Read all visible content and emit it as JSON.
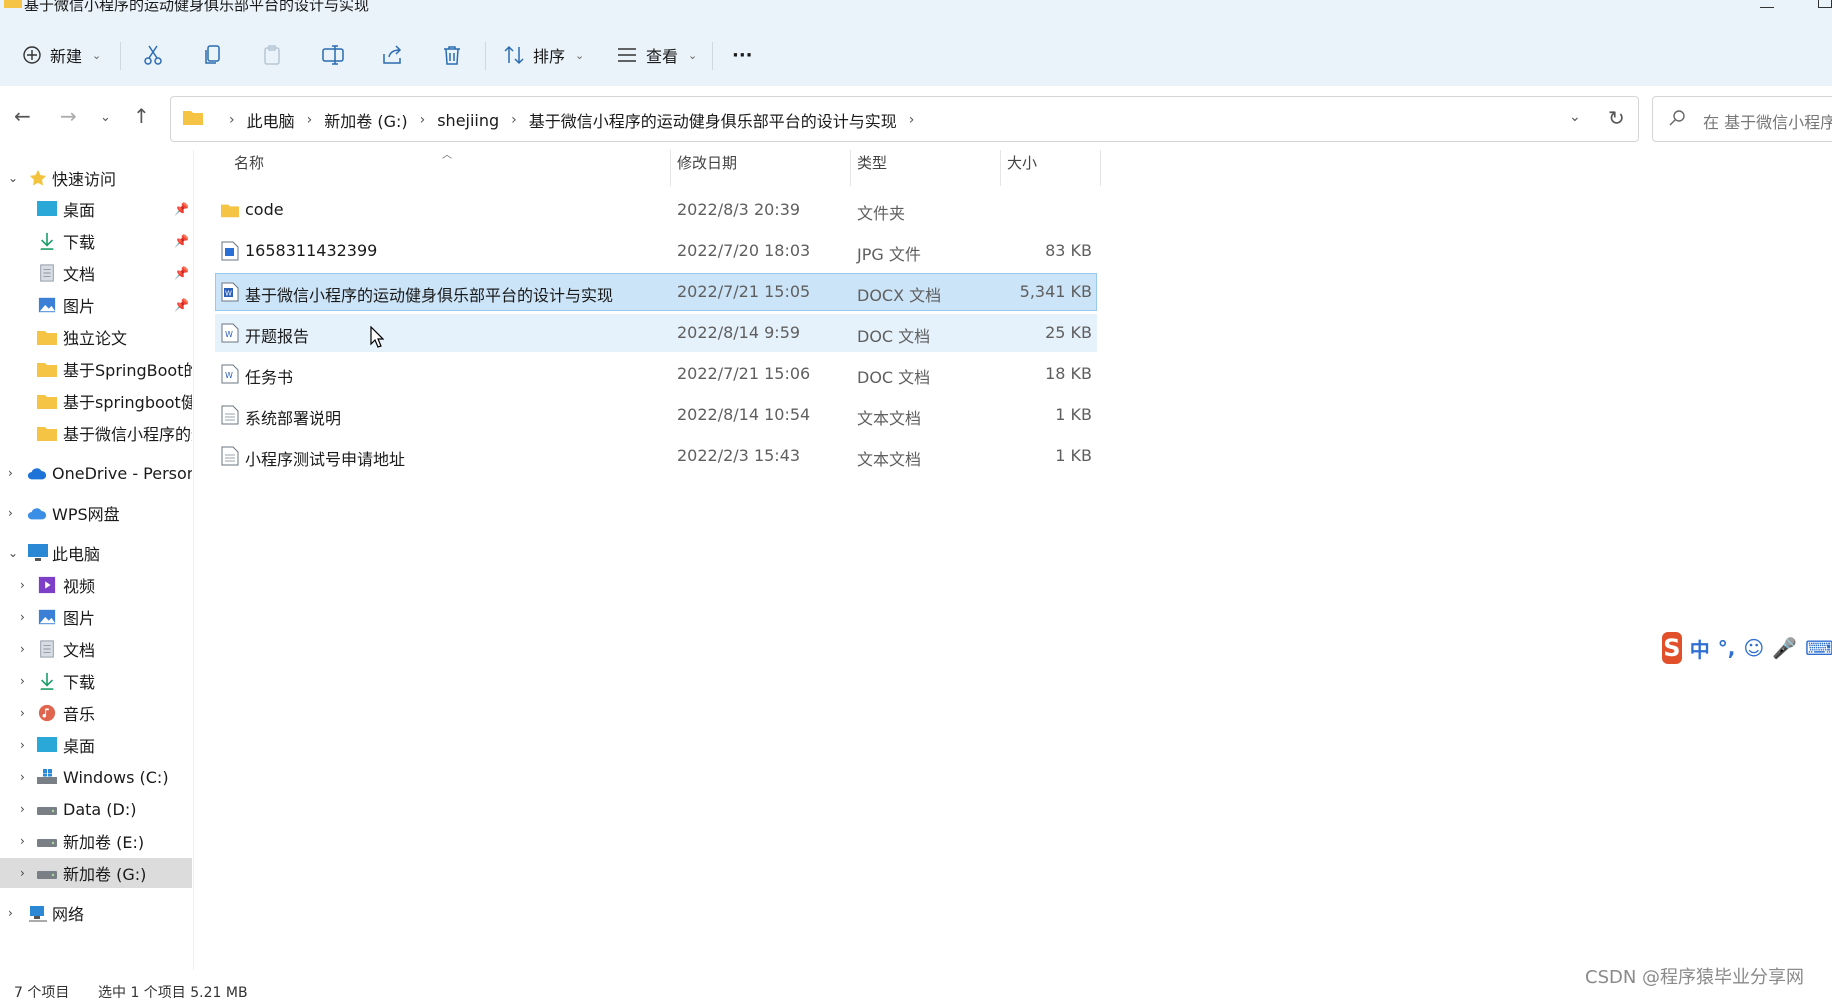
{
  "window": {
    "title": "基于微信小程序的运动健身俱乐部平台的设计与实现"
  },
  "toolbar": {
    "new_label": "新建",
    "sort_label": "排序",
    "view_label": "查看",
    "more_label": "···"
  },
  "address": {
    "crumbs": [
      "此电脑",
      "新加卷 (G:)",
      "shejiing",
      "基于微信小程序的运动健身俱乐部平台的设计与实现"
    ],
    "search_placeholder": "在 基于微信小程序的"
  },
  "nav": {
    "quick_access": "快速访问",
    "quick_items": [
      "桌面",
      "下载",
      "文档",
      "图片",
      "独立论文",
      "基于SpringBoot的",
      "基于springboot健",
      "基于微信小程序的运"
    ],
    "onedrive": "OneDrive - Persona",
    "wps": "WPS网盘",
    "this_pc": "此电脑",
    "pc_items": [
      "视频",
      "图片",
      "文档",
      "下载",
      "音乐",
      "桌面",
      "Windows (C:)",
      "Data (D:)",
      "新加卷 (E:)",
      "新加卷 (G:)"
    ],
    "network": "网络"
  },
  "columns": {
    "name": "名称",
    "date": "修改日期",
    "type": "类型",
    "size": "大小"
  },
  "files": [
    {
      "name": "code",
      "date": "2022/8/3 20:39",
      "type": "文件夹",
      "size": "",
      "icon": "folder-icon"
    },
    {
      "name": "1658311432399",
      "date": "2022/7/20 18:03",
      "type": "JPG 文件",
      "size": "83 KB",
      "icon": "image-file-icon"
    },
    {
      "name": "基于微信小程序的运动健身俱乐部平台的设计与实现",
      "date": "2022/7/21 15:05",
      "type": "DOCX 文档",
      "size": "5,341 KB",
      "icon": "word-doc-icon"
    },
    {
      "name": "开题报告",
      "date": "2022/8/14 9:59",
      "type": "DOC 文档",
      "size": "25 KB",
      "icon": "word-doc-icon"
    },
    {
      "name": "任务书",
      "date": "2022/7/21 15:06",
      "type": "DOC 文档",
      "size": "18 KB",
      "icon": "word-doc-icon"
    },
    {
      "name": "系统部署说明",
      "date": "2022/8/14 10:54",
      "type": "文本文档",
      "size": "1 KB",
      "icon": "text-file-icon"
    },
    {
      "name": "小程序测试号申请地址",
      "date": "2022/2/3 15:43",
      "type": "文本文档",
      "size": "1 KB",
      "icon": "text-file-icon"
    }
  ],
  "status": {
    "count": "7 个项目",
    "selection": "选中 1 个项目  5.21 MB"
  },
  "ime": {
    "mode": "中"
  },
  "watermark": "CSDN @程序猿毕业分享网",
  "colors": {
    "selected_row": "#cce4f7",
    "hover_row": "#e5f1fb",
    "command_bar": "#eaf3fa",
    "folder": "#f5c444"
  }
}
